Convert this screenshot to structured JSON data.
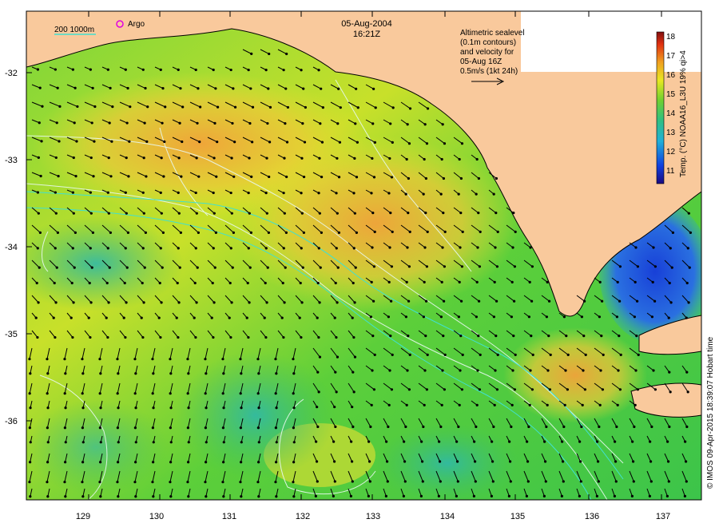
{
  "header": {
    "date": "05-Aug-2004",
    "time": "16:21Z"
  },
  "legend": {
    "scale_label": "200  1000m",
    "argo_label": "Argo"
  },
  "altimetry_note": {
    "line1": "Altimetric sealevel",
    "line2": "(0.1m contours)",
    "line3": "and velocity for",
    "line4": "05-Aug 16Z",
    "line5": "0.5m/s (1kt 24h)"
  },
  "colorbar": {
    "title": "Temp. (°C) NOAA16_L3U 19% qi>4",
    "ticks": [
      "18",
      "17",
      "16",
      "15",
      "14",
      "13",
      "12",
      "11"
    ]
  },
  "axes": {
    "lat_ticks": [
      "-32",
      "-33",
      "-34",
      "-35",
      "-36"
    ],
    "lon_ticks": [
      "129",
      "130",
      "131",
      "132",
      "133",
      "134",
      "135",
      "136",
      "137"
    ]
  },
  "credit": "© IMOS 09-Apr-2015 18:39:07 Hobart time",
  "colors": {
    "land": "#f9c99c",
    "coast_teal": "#40e0d0",
    "argo_marker": "#e000e0"
  }
}
